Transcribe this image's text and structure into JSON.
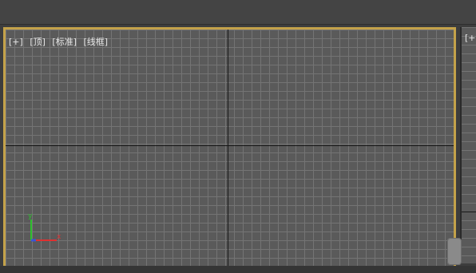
{
  "topbar": {
    "fragments": [
      "",
      "",
      ""
    ]
  },
  "viewport": {
    "labels": {
      "plus": "[+]",
      "view": "[顶]",
      "shading_standard": "[标准]",
      "shading_wire": "[线框]"
    },
    "gizmo": {
      "y_label": "y",
      "x_label": "x"
    }
  },
  "side_viewport": {
    "label": "[+"
  },
  "colors": {
    "viewport_border": "#c4a24a",
    "grid_bg": "#5a5a5a",
    "grid_line": "#747474",
    "axis_line": "#181818",
    "gizmo_y": "#2dbf2d",
    "gizmo_x": "#e03030",
    "gizmo_z": "#3a55d6"
  },
  "icons": [
    "axis-gizmo-icon",
    "scroll-handle-icon"
  ]
}
